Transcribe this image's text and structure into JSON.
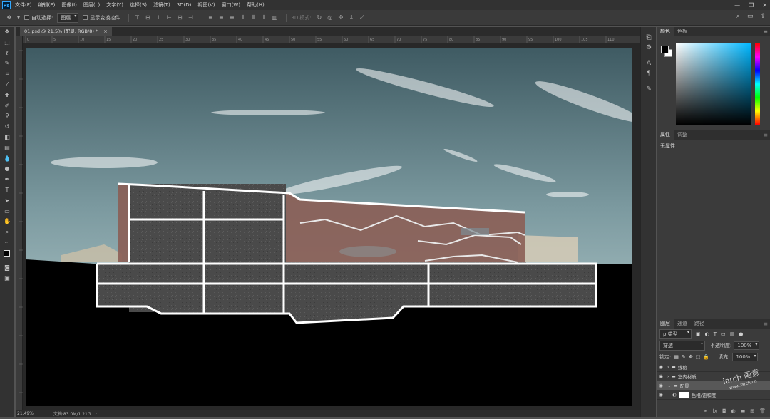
{
  "app": {
    "logo": "Ps"
  },
  "menu": [
    "文件(F)",
    "编辑(E)",
    "图像(I)",
    "图层(L)",
    "文字(Y)",
    "选择(S)",
    "滤镜(T)",
    "3D(D)",
    "视图(V)",
    "窗口(W)",
    "帮助(H)"
  ],
  "window_controls": {
    "minimize": "—",
    "restore": "❐",
    "close": "✕"
  },
  "options": {
    "auto_select_label": "自动选择:",
    "auto_select_value": "图层",
    "show_transform_label": "显示变换控件",
    "mode_3d_label": "3D 模式:"
  },
  "document": {
    "tab_title": "01.psd @ 21.5% (配景, RGB/8) *",
    "tab_close": "×"
  },
  "ruler_marks": [
    "0",
    "5",
    "10",
    "15",
    "20",
    "25",
    "30",
    "35",
    "40",
    "45",
    "50",
    "55",
    "60",
    "65",
    "70",
    "75",
    "80",
    "85",
    "90",
    "95",
    "100",
    "105",
    "110"
  ],
  "status": {
    "zoom": "21.49%",
    "doc": "文档:83.0M/1.21G"
  },
  "color_panel": {
    "tabs": [
      "颜色",
      "色板"
    ],
    "fg": "#000000",
    "bg": "#ffffff"
  },
  "properties_panel": {
    "tabs": [
      "属性",
      "调整"
    ],
    "content": "无属性"
  },
  "layers_panel": {
    "tabs": [
      "图层",
      "通道",
      "路径"
    ],
    "filter_label": "ρ 类型",
    "blend_mode": "穿透",
    "opacity_label": "不透明度:",
    "opacity_value": "100%",
    "lock_label": "锁定:",
    "fill_label": "填充:",
    "fill_value": "100%",
    "layers": [
      {
        "name": "线稿",
        "type": "folder"
      },
      {
        "name": "室内材质",
        "type": "folder"
      },
      {
        "name": "配景",
        "type": "folder",
        "selected": true
      },
      {
        "name": "色相/饱和度",
        "type": "adjustment"
      }
    ]
  },
  "watermark": {
    "text": "iarch 画意",
    "url": "www.iarch.cn"
  }
}
